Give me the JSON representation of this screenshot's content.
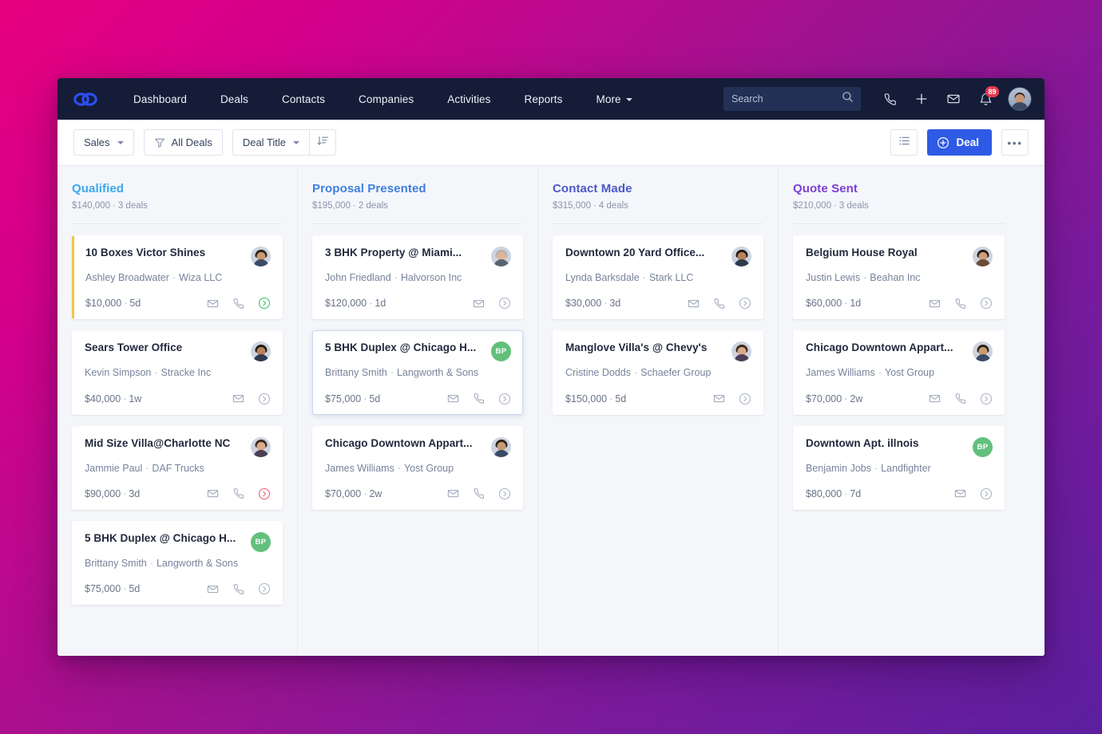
{
  "nav": {
    "logo_icon": "chain-link-logo",
    "links": [
      {
        "label": "Dashboard",
        "has_caret": false
      },
      {
        "label": "Deals",
        "has_caret": false
      },
      {
        "label": "Contacts",
        "has_caret": false
      },
      {
        "label": "Companies",
        "has_caret": false
      },
      {
        "label": "Activities",
        "has_caret": false
      },
      {
        "label": "Reports",
        "has_caret": false
      },
      {
        "label": "More",
        "has_caret": true
      }
    ],
    "search": {
      "placeholder": "Search",
      "icon": "search-icon"
    },
    "icons": [
      "phone-icon",
      "plus-icon",
      "mail-icon",
      "bell-icon"
    ],
    "notification_count": "89",
    "avatar": "user-avatar",
    "bg_color": "#141c37",
    "badge_color": "#e8384f"
  },
  "toolbar": {
    "pipeline_label": "Sales",
    "filter_label": "All Deals",
    "filter_icon": "funnel-icon",
    "sort_label": "Deal Title",
    "sort_icon": "sort-descending-icon",
    "list_view_icon": "list-view-icon",
    "add_deal_label": "Deal",
    "add_deal_icon": "circle-plus-icon",
    "more_label": "•••",
    "accent_color": "#2f5ae5"
  },
  "board": {
    "columns": [
      {
        "title": "Qualified",
        "color": "#39a7f0",
        "amount": "$140,000",
        "deals_count": "3 deals",
        "cards": [
          {
            "title": "10 Boxes Victor Shines",
            "contact": "Ashley Broadwater",
            "company": "Wiza LLC",
            "amount": "$10,000",
            "age": "5d",
            "avatar_type": "photo",
            "avatar_initials": "",
            "accent": true,
            "selected": false,
            "actions": [
              "mail-icon",
              "phone-icon",
              "chevron-circle-right-icon"
            ],
            "status_color": "green"
          },
          {
            "title": "Sears Tower Office",
            "contact": "Kevin Simpson",
            "company": "Stracke Inc",
            "amount": "$40,000",
            "age": "1w",
            "avatar_type": "photo",
            "avatar_initials": "",
            "accent": false,
            "selected": false,
            "actions": [
              "mail-icon",
              "chevron-circle-right-icon"
            ],
            "status_color": "gray"
          },
          {
            "title": "Mid Size Villa@Charlotte NC",
            "contact": "Jammie Paul",
            "company": "DAF Trucks",
            "amount": "$90,000",
            "age": "3d",
            "avatar_type": "photo",
            "avatar_initials": "",
            "accent": false,
            "selected": false,
            "actions": [
              "mail-icon",
              "phone-icon",
              "chevron-circle-right-icon"
            ],
            "status_color": "red"
          },
          {
            "title": "5 BHK Duplex @ Chicago H...",
            "contact": "Brittany Smith",
            "company": "Langworth & Sons",
            "amount": "$75,000",
            "age": "5d",
            "avatar_type": "initials",
            "avatar_initials": "BP",
            "accent": false,
            "selected": false,
            "actions": [
              "mail-icon",
              "phone-icon",
              "chevron-circle-right-icon"
            ],
            "status_color": "gray"
          }
        ]
      },
      {
        "title": "Proposal Presented",
        "color": "#3f7fe0",
        "amount": "$195,000",
        "deals_count": "2 deals",
        "cards": [
          {
            "title": "3 BHK Property @ Miami...",
            "contact": "John Friedland",
            "company": "Halvorson Inc",
            "amount": "$120,000",
            "age": "1d",
            "avatar_type": "photo",
            "avatar_initials": "",
            "accent": false,
            "selected": false,
            "actions": [
              "mail-icon",
              "chevron-circle-right-icon"
            ],
            "status_color": "gray"
          },
          {
            "title": "5 BHK Duplex @ Chicago H...",
            "contact": "Brittany Smith",
            "company": "Langworth & Sons",
            "amount": "$75,000",
            "age": "5d",
            "avatar_type": "initials",
            "avatar_initials": "BP",
            "accent": false,
            "selected": true,
            "actions": [
              "mail-icon",
              "phone-icon",
              "chevron-circle-right-icon"
            ],
            "status_color": "gray"
          },
          {
            "title": "Chicago Downtown Appart...",
            "contact": "James Williams",
            "company": "Yost Group",
            "amount": "$70,000",
            "age": "2w",
            "avatar_type": "photo",
            "avatar_initials": "",
            "accent": false,
            "selected": false,
            "actions": [
              "mail-icon",
              "phone-icon",
              "chevron-circle-right-icon"
            ],
            "status_color": "gray"
          }
        ]
      },
      {
        "title": "Contact Made",
        "color": "#4b57c9",
        "amount": "$315,000",
        "deals_count": "4 deals",
        "cards": [
          {
            "title": "Downtown 20 Yard Office...",
            "contact": "Lynda Barksdale",
            "company": "Stark LLC",
            "amount": "$30,000",
            "age": "3d",
            "avatar_type": "photo",
            "avatar_initials": "",
            "accent": false,
            "selected": false,
            "actions": [
              "mail-icon",
              "phone-icon",
              "chevron-circle-right-icon"
            ],
            "status_color": "gray"
          },
          {
            "title": "Manglove Villa's @ Chevy's",
            "contact": "Cristine Dodds",
            "company": "Schaefer Group",
            "amount": "$150,000",
            "age": "5d",
            "avatar_type": "photo",
            "avatar_initials": "",
            "accent": false,
            "selected": false,
            "actions": [
              "mail-icon",
              "chevron-circle-right-icon"
            ],
            "status_color": "gray"
          }
        ]
      },
      {
        "title": "Quote Sent",
        "color": "#7b3fd4",
        "amount": "$210,000",
        "deals_count": "3 deals",
        "cards": [
          {
            "title": "Belgium House Royal",
            "contact": "Justin Lewis",
            "company": "Beahan Inc",
            "amount": "$60,000",
            "age": "1d",
            "avatar_type": "photo",
            "avatar_initials": "",
            "accent": false,
            "selected": false,
            "actions": [
              "mail-icon",
              "phone-icon",
              "chevron-circle-right-icon"
            ],
            "status_color": "gray"
          },
          {
            "title": "Chicago Downtown Appart...",
            "contact": "James Williams",
            "company": "Yost Group",
            "amount": "$70,000",
            "age": "2w",
            "avatar_type": "photo",
            "avatar_initials": "",
            "accent": false,
            "selected": false,
            "actions": [
              "mail-icon",
              "phone-icon",
              "chevron-circle-right-icon"
            ],
            "status_color": "gray"
          },
          {
            "title": "Downtown Apt. illnois",
            "contact": "Benjamin Jobs",
            "company": "Landfighter",
            "amount": "$80,000",
            "age": "7d",
            "avatar_type": "initials",
            "avatar_initials": "BP",
            "accent": false,
            "selected": false,
            "actions": [
              "mail-icon",
              "chevron-circle-right-icon"
            ],
            "status_color": "gray"
          }
        ]
      }
    ]
  }
}
